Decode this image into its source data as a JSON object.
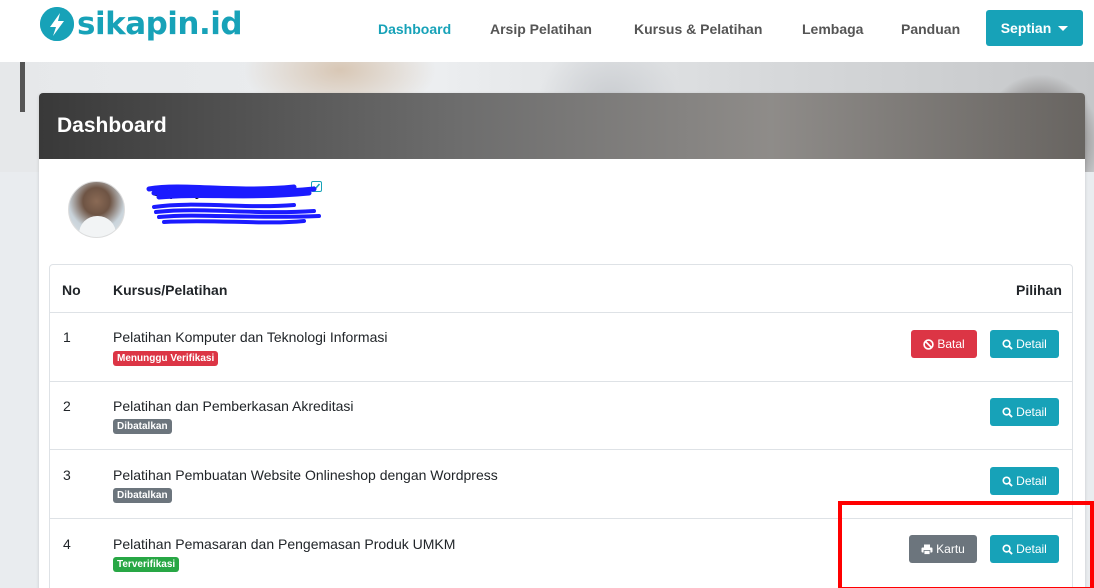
{
  "brand": {
    "name": "sikapin.id",
    "color": "#17a2b8"
  },
  "nav": {
    "items": [
      {
        "label": "Dashboard",
        "active": true
      },
      {
        "label": "Arsip Pelatihan",
        "active": false
      },
      {
        "label": "Kursus & Pelatihan",
        "active": false
      },
      {
        "label": "Lembaga",
        "active": false
      },
      {
        "label": "Panduan",
        "active": false
      }
    ],
    "user_label": "Septian"
  },
  "page": {
    "title": "Dashboard"
  },
  "profile": {
    "name": "Septi tyo",
    "verified_icon": "check-square-icon"
  },
  "table": {
    "headers": {
      "no": "No",
      "course": "Kursus/Pelatihan",
      "options": "Pilihan"
    },
    "rows": [
      {
        "no": "1",
        "title": "Pelatihan Komputer dan Teknologi Informasi",
        "status": "Menunggu Verifikasi",
        "status_color": "#dc3545",
        "actions": [
          "Batal",
          "Detail"
        ]
      },
      {
        "no": "2",
        "title": "Pelatihan dan Pemberkasan Akreditasi",
        "status": "Dibatalkan",
        "status_color": "#6c757d",
        "actions": [
          "Detail"
        ]
      },
      {
        "no": "3",
        "title": "Pelatihan Pembuatan Website Onlineshop dengan Wordpress",
        "status": "Dibatalkan",
        "status_color": "#6c757d",
        "actions": [
          "Detail"
        ]
      },
      {
        "no": "4",
        "title": "Pelatihan Pemasaran dan Pengemasan Produk UMKM",
        "status": "Terverifikasi",
        "status_color": "#28a745",
        "actions": [
          "Kartu",
          "Detail"
        ]
      }
    ]
  },
  "buttons": {
    "batal": "Batal",
    "detail": "Detail",
    "kartu": "Kartu"
  },
  "icons": {
    "cancel": "ban-icon",
    "detail": "search-icon",
    "kartu": "print-icon"
  },
  "annotation": {
    "highlight_color": "#ff0000"
  }
}
